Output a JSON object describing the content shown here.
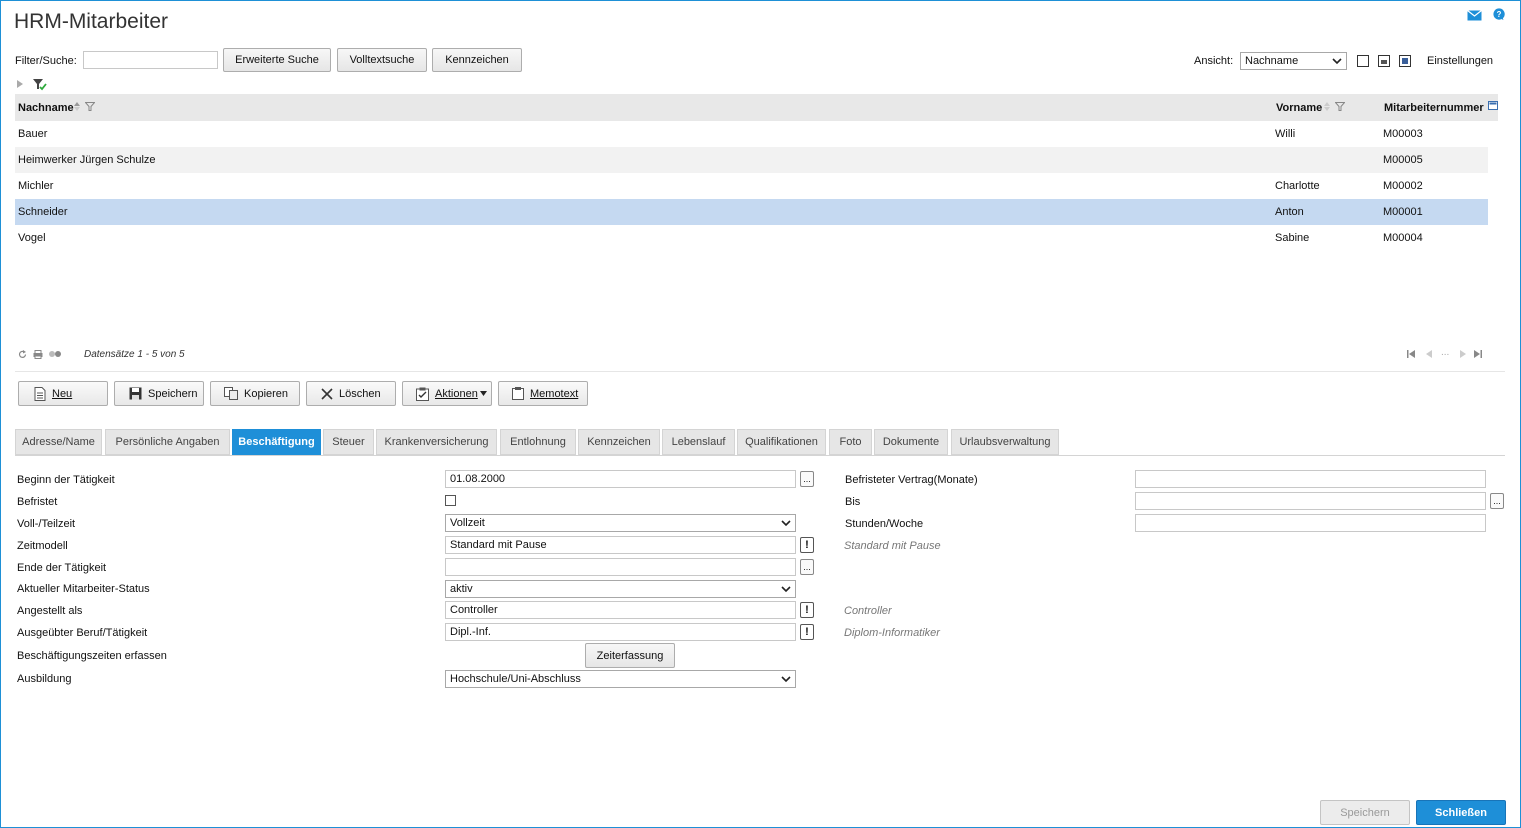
{
  "app": {
    "title": "HRM-Mitarbeiter"
  },
  "icons": {
    "mail": "mail-icon",
    "help": "help-icon"
  },
  "colors": {
    "accent": "#1e8fd8",
    "selected_row": "#c5d9f1"
  },
  "search": {
    "label": "Filter/Suche:",
    "value": "",
    "extended_label": "Erweiterte Suche",
    "fulltext_label": "Volltextsuche",
    "marks_label": "Kennzeichen"
  },
  "view": {
    "label": "Ansicht:",
    "selected": "Nachname",
    "settings_label": "Einstellungen"
  },
  "grid": {
    "columns": [
      "Nachname",
      "Vorname",
      "Mitarbeiternummer"
    ],
    "rows": [
      {
        "nachname": "Bauer",
        "vorname": "Willi",
        "nummer": "M00003"
      },
      {
        "nachname": "Heimwerker Jürgen Schulze",
        "vorname": "",
        "nummer": "M00005"
      },
      {
        "nachname": "Michler",
        "vorname": "Charlotte",
        "nummer": "M00002"
      },
      {
        "nachname": "Schneider",
        "vorname": "Anton",
        "nummer": "M00001"
      },
      {
        "nachname": "Vogel",
        "vorname": "Sabine",
        "nummer": "M00004"
      }
    ],
    "selected_row": 3,
    "records_text": "Datensätze 1 - 5 von 5",
    "pager_ellipsis": "..."
  },
  "actions": {
    "new": "Neu",
    "save": "Speichern",
    "copy": "Kopieren",
    "delete": "Löschen",
    "actions": "Aktionen",
    "memo": "Memotext"
  },
  "tabs": [
    "Adresse/Name",
    "Persönliche Angaben",
    "Beschäftigung",
    "Steuer",
    "Krankenversicherung",
    "Entlohnung",
    "Kennzeichen",
    "Lebenslauf",
    "Qualifikationen",
    "Foto",
    "Dokumente",
    "Urlaubsverwaltung"
  ],
  "active_tab": "Beschäftigung",
  "form": {
    "beginn_label": "Beginn der Tätigkeit",
    "beginn_value": "01.08.2000",
    "befristet_label": "Befristet",
    "befristet_checked": false,
    "voll_label": "Voll-/Teilzeit",
    "voll_value": "Vollzeit",
    "zeitmodell_label": "Zeitmodell",
    "zeitmodell_value": "Standard mit Pause",
    "zeitmodell_hint": "Standard mit Pause",
    "ende_label": "Ende der Tätigkeit",
    "ende_value": "",
    "status_label": "Aktueller Mitarbeiter-Status",
    "status_value": "aktiv",
    "angestellt_label": "Angestellt als",
    "angestellt_value": "Controller",
    "angestellt_hint": "Controller",
    "beruf_label": "Ausgeübter Beruf/Tätigkeit",
    "beruf_value": "Dipl.-Inf.",
    "beruf_hint": "Diplom-Informatiker",
    "zeiten_label": "Beschäftigungszeiten erfassen",
    "zeiten_button": "Zeiterfassung",
    "ausbildung_label": "Ausbildung",
    "ausbildung_value": "Hochschule/Uni-Abschluss",
    "befrist_vertrag_label": "Befristeter Vertrag(Monate)",
    "befrist_vertrag_value": "",
    "bis_label": "Bis",
    "bis_value": "",
    "stunden_label": "Stunden/Woche",
    "stunden_value": "",
    "dots": "..."
  },
  "footer": {
    "save": "Speichern",
    "close": "Schließen"
  }
}
